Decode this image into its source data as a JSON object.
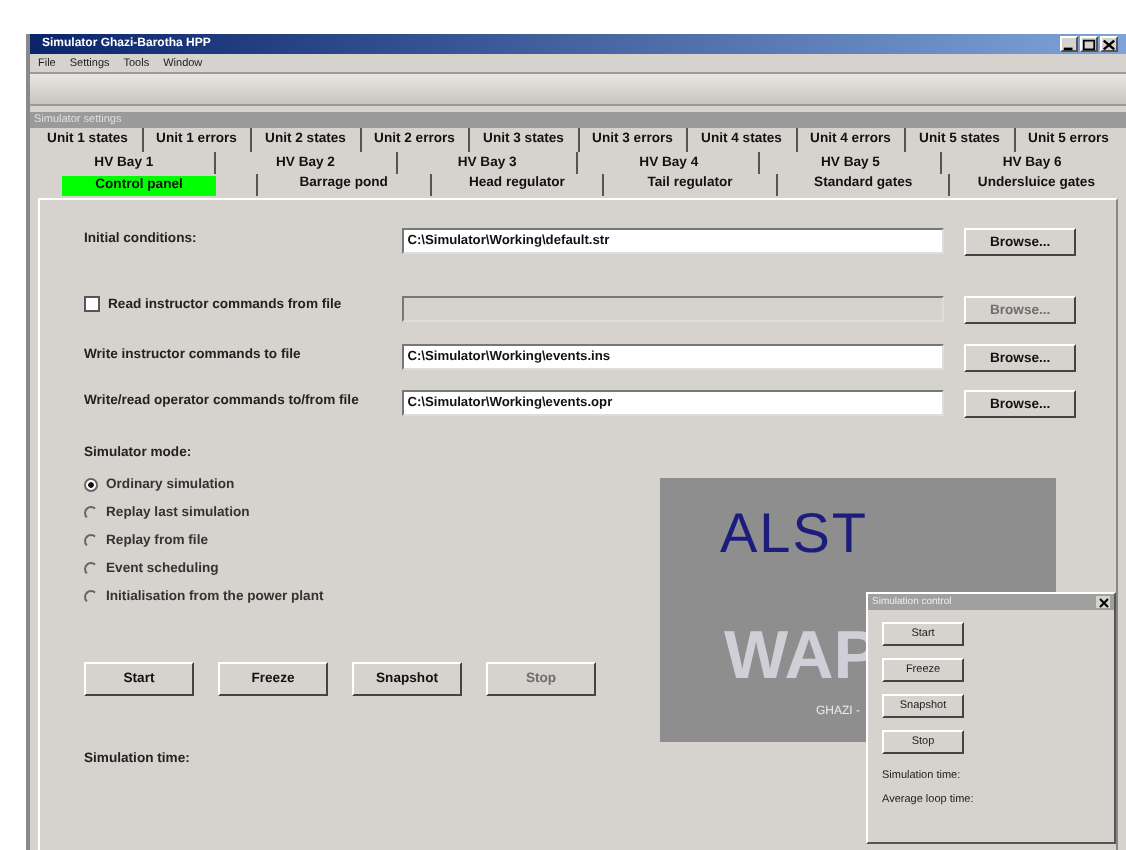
{
  "main_window": {
    "title": "Simulator Ghazi-Barotha HPP",
    "menu": [
      "File",
      "Settings",
      "Tools",
      "Window"
    ]
  },
  "settings_window": {
    "title": "Simulator settings"
  },
  "tab_rows": [
    {
      "tabs": [
        {
          "label": "Unit 1 states",
          "selected": false
        },
        {
          "label": "Unit 1 errors",
          "selected": false
        },
        {
          "label": "Unit 2 states",
          "selected": false
        },
        {
          "label": "Unit 2 errors",
          "selected": false
        },
        {
          "label": "Unit 3 states",
          "selected": false
        },
        {
          "label": "Unit 3 errors",
          "selected": false
        },
        {
          "label": "Unit 4 states",
          "selected": false
        },
        {
          "label": "Unit 4 errors",
          "selected": false
        },
        {
          "label": "Unit 5 states",
          "selected": false
        },
        {
          "label": "Unit 5 errors",
          "selected": false
        }
      ]
    },
    {
      "tabs": [
        {
          "label": "HV Bay 1",
          "selected": false
        },
        {
          "label": "HV Bay 2",
          "selected": false
        },
        {
          "label": "HV Bay 3",
          "selected": false
        },
        {
          "label": "HV Bay 4",
          "selected": false
        },
        {
          "label": "HV Bay 5",
          "selected": false
        },
        {
          "label": "HV Bay 6",
          "selected": false
        }
      ]
    },
    {
      "tabs": [
        {
          "label": "Control panel",
          "selected": true
        },
        {
          "label": "Barrage pond",
          "selected": false
        },
        {
          "label": "Head regulator",
          "selected": false
        },
        {
          "label": "Tail regulator",
          "selected": false
        },
        {
          "label": "Standard gates",
          "selected": false
        },
        {
          "label": "Undersluice gates",
          "selected": false
        }
      ]
    }
  ],
  "file_rows": [
    {
      "kind": "plain",
      "label": "Initial conditions:",
      "value": "C:\\Simulator\\Working\\default.str",
      "button": "Browse...",
      "disabled": false
    },
    {
      "kind": "checkbox",
      "label": "Read instructor commands from file",
      "checked": false,
      "button": "Browse...",
      "disabled": true
    },
    {
      "kind": "plain",
      "label": "Write instructor commands to file",
      "value": "C:\\Simulator\\Working\\events.ins",
      "button": "Browse...",
      "disabled": false
    },
    {
      "kind": "plain",
      "label": "Write/read operator commands to/from file",
      "value": "C:\\Simulator\\Working\\events.opr",
      "button": "Browse...",
      "disabled": false
    }
  ],
  "mode": {
    "title": "Simulator mode:",
    "options": [
      {
        "label": "Ordinary simulation",
        "selected": true
      },
      {
        "label": "Replay last simulation",
        "selected": false
      },
      {
        "label": "Replay from file",
        "selected": false
      },
      {
        "label": "Event scheduling",
        "selected": false
      },
      {
        "label": "Initialisation from the power plant",
        "selected": false
      }
    ]
  },
  "buttons": [
    {
      "label": "Start",
      "disabled": false
    },
    {
      "label": "Freeze",
      "disabled": false
    },
    {
      "label": "Snapshot",
      "disabled": false
    },
    {
      "label": "Stop",
      "disabled": true
    }
  ],
  "time_label": "Simulation time:",
  "logo": {
    "brand": "ALST",
    "product": "WAP",
    "caption": "GHAZI -"
  },
  "control_dialog": {
    "title": "Simulation control",
    "buttons": [
      "Start",
      "Freeze",
      "Snapshot",
      "Stop"
    ],
    "readouts": [
      "Simulation time:",
      "Average loop time:"
    ]
  }
}
